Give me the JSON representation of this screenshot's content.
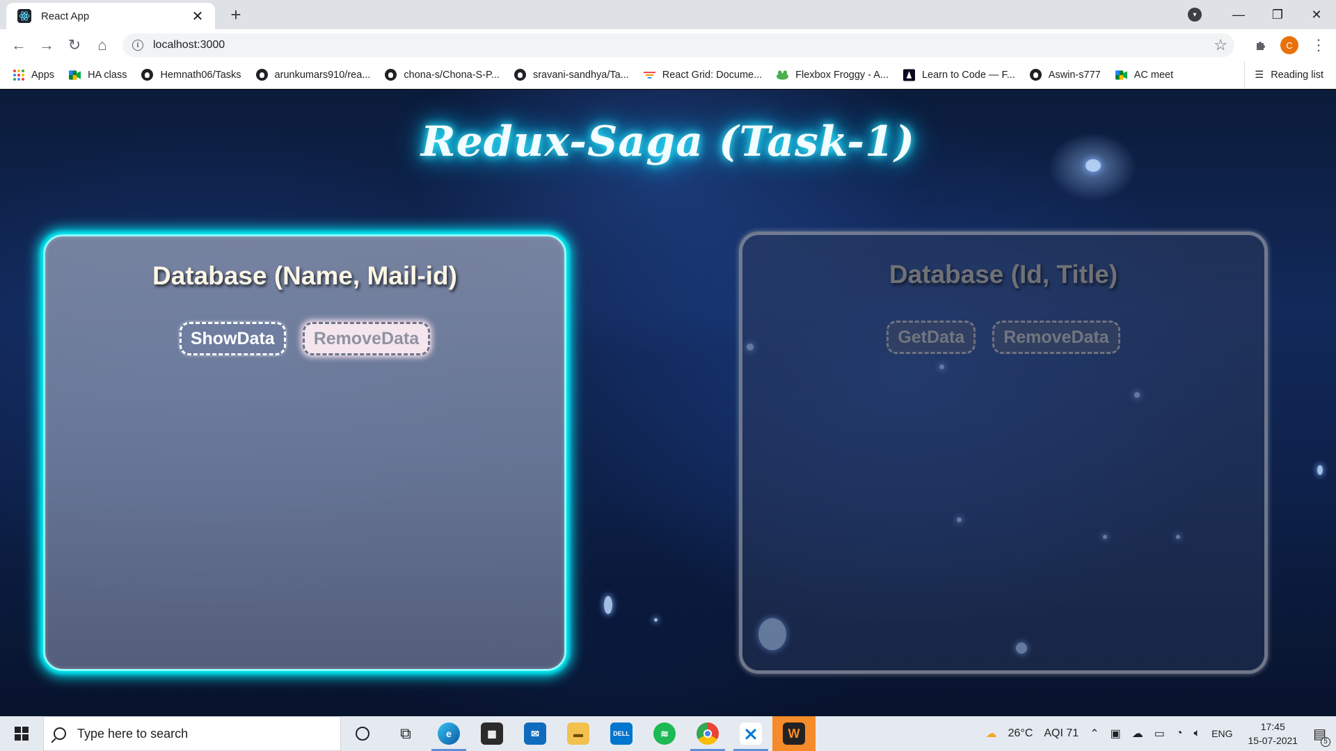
{
  "browser": {
    "tab_title": "React App",
    "url": "localhost:3000",
    "profile_initial": "C",
    "bookmarks": [
      {
        "label": "Apps",
        "icon": "apps-grid-icon"
      },
      {
        "label": "HA class",
        "icon": "meet-icon"
      },
      {
        "label": "Hemnath06/Tasks",
        "icon": "github-icon"
      },
      {
        "label": "arunkumars910/rea...",
        "icon": "github-icon"
      },
      {
        "label": "chona-s/Chona-S-P...",
        "icon": "github-icon"
      },
      {
        "label": "sravani-sandhya/Ta...",
        "icon": "github-icon"
      },
      {
        "label": "React Grid: Docume...",
        "icon": "react-grid-icon"
      },
      {
        "label": "Flexbox Froggy - A...",
        "icon": "frog-icon"
      },
      {
        "label": "Learn to Code — F...",
        "icon": "freecodecamp-icon"
      },
      {
        "label": "Aswin-s777",
        "icon": "github-icon"
      },
      {
        "label": "AC meet",
        "icon": "meet-icon"
      }
    ],
    "reading_list": "Reading list"
  },
  "page": {
    "title": "Redux-Saga (Task-1)",
    "left_panel": {
      "heading": "Database (Name, Mail-id)",
      "show_button": "ShowData",
      "remove_button": "RemoveData"
    },
    "right_panel": {
      "heading": "Database (Id, Title)",
      "get_button": "GetData",
      "remove_button": "RemoveData"
    }
  },
  "taskbar": {
    "search_placeholder": "Type here to search",
    "weather": "26°C",
    "aqi": "AQI 71",
    "language": "ENG",
    "time": "17:45",
    "date": "15-07-2021",
    "notification_count": "5"
  },
  "colors": {
    "accent_glow": "#00e6f0",
    "title_glow": "#00d5ff",
    "taskbar_active": "#f58b2a"
  }
}
